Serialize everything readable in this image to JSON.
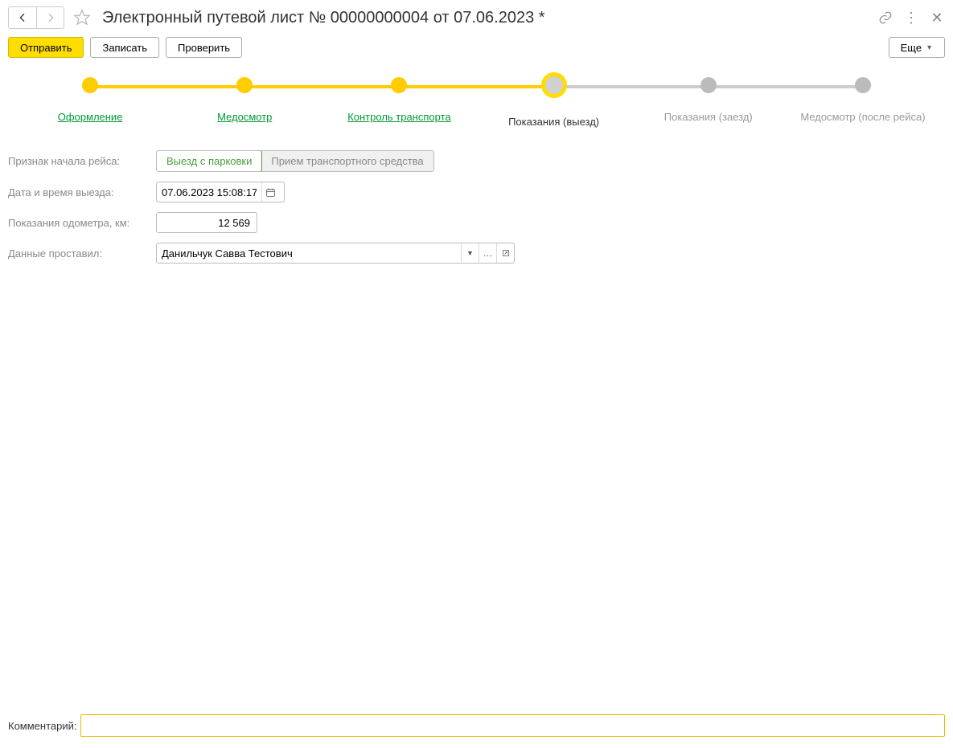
{
  "header": {
    "title": "Электронный путевой лист № 00000000004 от 07.06.2023 *"
  },
  "toolbar": {
    "send": "Отправить",
    "save": "Записать",
    "check": "Проверить",
    "more": "Еще"
  },
  "stepper": {
    "steps": [
      {
        "label": "Оформление"
      },
      {
        "label": "Медосмотр"
      },
      {
        "label": "Контроль транспорта"
      },
      {
        "label": "Показания (выезд)"
      },
      {
        "label": "Показания (заезд)"
      },
      {
        "label": "Медосмотр (после рейса)"
      }
    ]
  },
  "form": {
    "trip_start_label": "Признак начала рейса:",
    "trip_start_a": "Выезд с парковки",
    "trip_start_b": "Прием транспортного средства",
    "datetime_label": "Дата и время выезда:",
    "datetime_value": "07.06.2023 15:08:17",
    "odometer_label": "Показания одометра, км:",
    "odometer_value": "12 569",
    "person_label": "Данные проставил:",
    "person_value": "Данильчук Савва Тестович"
  },
  "comment": {
    "label": "Комментарий:",
    "value": ""
  }
}
